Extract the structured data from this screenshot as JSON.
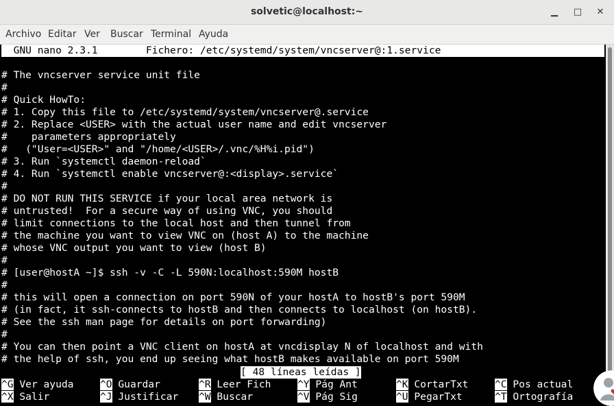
{
  "window": {
    "title": "solvetic@localhost:~"
  },
  "menu": [
    "Archivo",
    "Editar",
    "Ver",
    "Buscar",
    "Terminal",
    "Ayuda"
  ],
  "nano": {
    "header": "  GNU nano 2.3.1        Fichero: /etc/systemd/system/vncserver@:1.service",
    "lines": [
      "",
      "# The vncserver service unit file",
      "#",
      "# Quick HowTo:",
      "# 1. Copy this file to /etc/systemd/system/vncserver@.service",
      "# 2. Replace <USER> with the actual user name and edit vncserver",
      "#    parameters appropriately",
      "#   (\"User=<USER>\" and \"/home/<USER>/.vnc/%H%i.pid\")",
      "# 3. Run `systemctl daemon-reload`",
      "# 4. Run `systemctl enable vncserver@:<display>.service`",
      "#",
      "# DO NOT RUN THIS SERVICE if your local area network is",
      "# untrusted!  For a secure way of using VNC, you should",
      "# limit connections to the local host and then tunnel from",
      "# the machine you want to view VNC on (host A) to the machine",
      "# whose VNC output you want to view (host B)",
      "#",
      "# [user@hostA ~]$ ssh -v -C -L 590N:localhost:590M hostB",
      "#",
      "# this will open a connection on port 590N of your hostA to hostB's port 590M",
      "# (in fact, it ssh-connects to hostB and then connects to localhost (on hostB).",
      "# See the ssh man page for details on port forwarding)",
      "#",
      "# You can then point a VNC client on hostA at vncdisplay N of localhost and with",
      "# the help of ssh, you end up seeing what hostB makes available on port 590M"
    ],
    "status": "[ 48 líneas leídas ]",
    "shortcuts_row1": [
      {
        "key": "^G",
        "label": "Ver ayuda"
      },
      {
        "key": "^O",
        "label": "Guardar"
      },
      {
        "key": "^R",
        "label": "Leer Fich"
      },
      {
        "key": "^Y",
        "label": "Pág Ant"
      },
      {
        "key": "^K",
        "label": "CortarTxt"
      },
      {
        "key": "^C",
        "label": "Pos actual"
      }
    ],
    "shortcuts_row2": [
      {
        "key": "^X",
        "label": "Salir"
      },
      {
        "key": "^J",
        "label": "Justificar"
      },
      {
        "key": "^W",
        "label": "Buscar"
      },
      {
        "key": "^V",
        "label": "Pág Sig"
      },
      {
        "key": "^U",
        "label": "PegarTxt"
      },
      {
        "key": "^T",
        "label": "Ortografía"
      }
    ]
  },
  "icons": {
    "minimize": "minimize-icon",
    "maximize": "maximize-icon",
    "close": "close-icon",
    "logo": "solvetic-logo-icon"
  }
}
